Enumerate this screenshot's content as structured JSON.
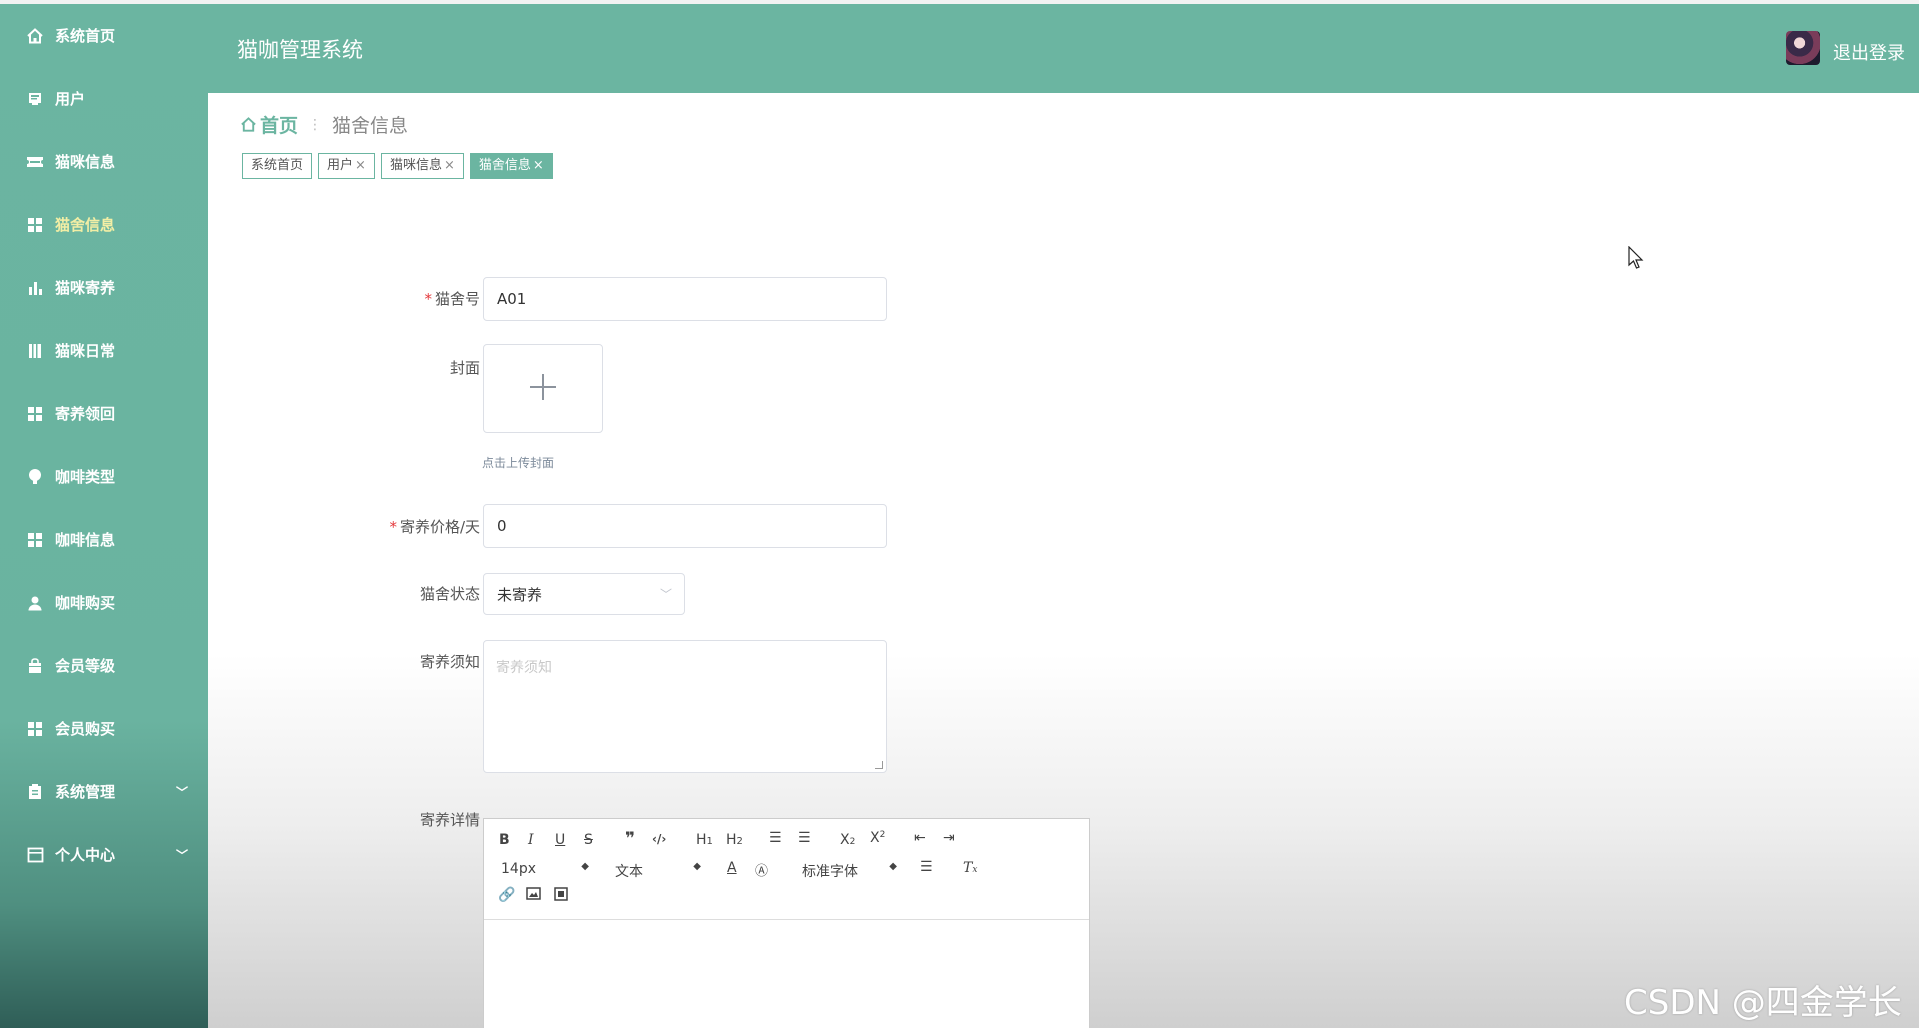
{
  "app": {
    "title": "猫咖管理系统"
  },
  "header": {
    "logout": "退出登录"
  },
  "sidebar": {
    "items": [
      {
        "label": "系统首页",
        "icon": "home-icon"
      },
      {
        "label": "用户",
        "icon": "user-card-icon"
      },
      {
        "label": "猫咪信息",
        "icon": "ticket-icon"
      },
      {
        "label": "猫舍信息",
        "icon": "grid-icon",
        "active": true
      },
      {
        "label": "猫咪寄养",
        "icon": "bar-chart-icon"
      },
      {
        "label": "猫咪日常",
        "icon": "book-icon"
      },
      {
        "label": "寄养领回",
        "icon": "grid-icon"
      },
      {
        "label": "咖啡类型",
        "icon": "bulb-icon"
      },
      {
        "label": "咖啡信息",
        "icon": "grid-icon"
      },
      {
        "label": "咖啡购买",
        "icon": "person-icon"
      },
      {
        "label": "会员等级",
        "icon": "bag-icon"
      },
      {
        "label": "会员购买",
        "icon": "grid-icon"
      },
      {
        "label": "系统管理",
        "icon": "clipboard-icon",
        "expandable": true
      },
      {
        "label": "个人中心",
        "icon": "window-icon",
        "expandable": true
      }
    ]
  },
  "breadcrumb": {
    "home": "首页",
    "sep": "⋮",
    "current": "猫舍信息"
  },
  "tags": [
    {
      "label": "系统首页",
      "closable": false
    },
    {
      "label": "用户",
      "closable": true
    },
    {
      "label": "猫咪信息",
      "closable": true
    },
    {
      "label": "猫舍信息",
      "closable": true,
      "active": true
    }
  ],
  "form": {
    "cattery_no": {
      "label": "猫舍号",
      "value": "A01",
      "required": true
    },
    "cover": {
      "label": "封面",
      "hint": "点击上传封面"
    },
    "price": {
      "label": "寄养价格/天",
      "value": "0",
      "required": true
    },
    "status": {
      "label": "猫舍状态",
      "value": "未寄养"
    },
    "notice": {
      "label": "寄养须知",
      "placeholder": "寄养须知"
    },
    "detail": {
      "label": "寄养详情"
    }
  },
  "editor": {
    "font_size": "14px",
    "text_type": "文本",
    "font_family": "标准字体"
  },
  "watermark": "CSDN @四金学长",
  "colors": {
    "primary": "#6bb5a1",
    "active_menu": "#f2eea5",
    "required": "#e4393c"
  }
}
